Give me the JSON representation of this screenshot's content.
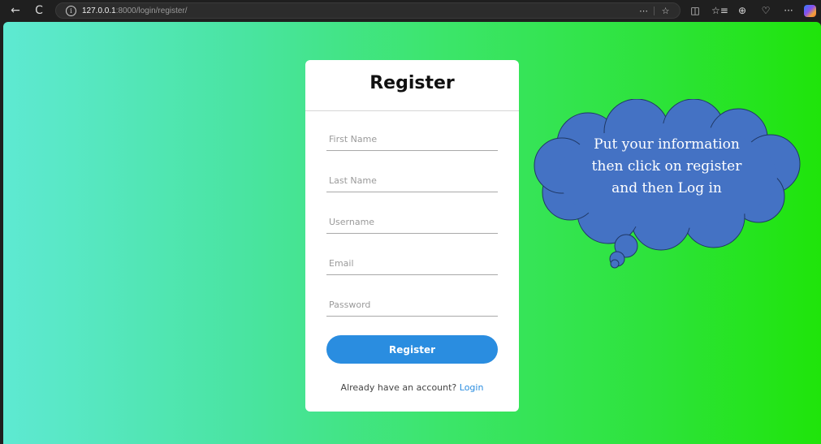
{
  "browser": {
    "url_host": "127.0.0.1",
    "url_rest": ":8000/login/register/",
    "back_icon": "←",
    "refresh_icon": "C",
    "info_icon": "i",
    "page_menu_icon": "⋯",
    "favorite_icon": "☆",
    "split_icon": "◫",
    "favorites_list_icon": "☆≡",
    "collections_icon": "⊕",
    "health_icon": "♡",
    "more_icon": "···"
  },
  "register": {
    "title": "Register",
    "fields": [
      {
        "placeholder": "First Name",
        "value": ""
      },
      {
        "placeholder": "Last Name",
        "value": ""
      },
      {
        "placeholder": "Username",
        "value": ""
      },
      {
        "placeholder": "Email",
        "value": ""
      },
      {
        "placeholder": "Password",
        "value": ""
      }
    ],
    "button_label": "Register",
    "login_prompt": "Already have an account?",
    "login_link": "Login"
  },
  "callout": {
    "lines": [
      "Put your information",
      "then click on register",
      "and then Log in"
    ],
    "fill_color": "#4472c4"
  },
  "colors": {
    "gradient_left": "#5ee9d2",
    "gradient_right": "#1fe40a",
    "button": "#2a8de0",
    "link": "#2a8de0"
  }
}
